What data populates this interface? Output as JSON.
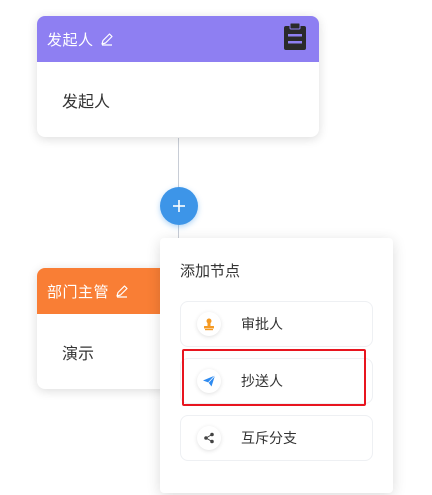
{
  "initiator_node": {
    "title": "发起人",
    "content": "发起人",
    "header_color": "#8e7ff2"
  },
  "approver_node": {
    "title": "部门主管",
    "content": "演示",
    "header_color": "#f97e35"
  },
  "add_button": {
    "label": "+"
  },
  "add_node_menu": {
    "title": "添加节点",
    "options": [
      {
        "label": "审批人",
        "icon": "stamp-icon",
        "color": "#f59a23"
      },
      {
        "label": "抄送人",
        "icon": "send-icon",
        "color": "#2f8bf0"
      },
      {
        "label": "互斥分支",
        "icon": "share-icon",
        "color": "#444444"
      }
    ]
  },
  "colors": {
    "connector": "#c8cdd6",
    "add_button": "#3d95e8",
    "highlight": "#e8151f"
  }
}
